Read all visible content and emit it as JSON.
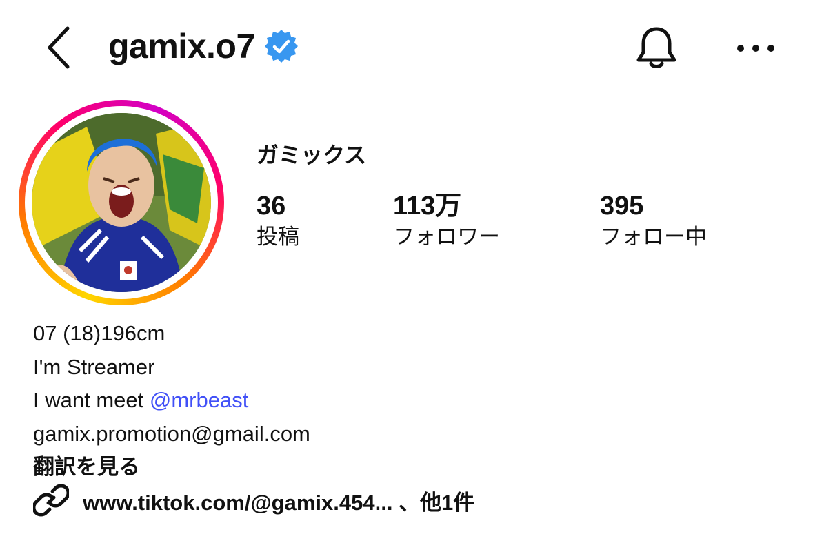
{
  "header": {
    "username": "gamix.o7",
    "verified": true,
    "icons": {
      "back": "chevron-left-icon",
      "notifications": "bell-icon",
      "more": "more-horizontal-icon",
      "verified": "verified-badge-icon"
    }
  },
  "profile": {
    "display_name": "ガミックス",
    "stats": {
      "posts": {
        "value": "36",
        "label": "投稿"
      },
      "followers": {
        "value": "113万",
        "label": "フォロワー"
      },
      "following": {
        "value": "395",
        "label": "フォロー中"
      }
    },
    "bio": {
      "line1": "07 (18)196cm",
      "line2": "I'm Streamer",
      "line3_prefix": "I want meet ",
      "line3_mention": "@mrbeast",
      "line4": "gamix.promotion@gmail.com"
    },
    "translate_label": "翻訳を見る",
    "link": {
      "text": "www.tiktok.com/@gamix.454... 、他1件",
      "icon": "link-icon"
    }
  },
  "colors": {
    "verified": "#3897f0",
    "mention": "#4150f7",
    "story_ring": [
      "#ffd600",
      "#ff7a00",
      "#ff0069",
      "#d300c5"
    ]
  }
}
